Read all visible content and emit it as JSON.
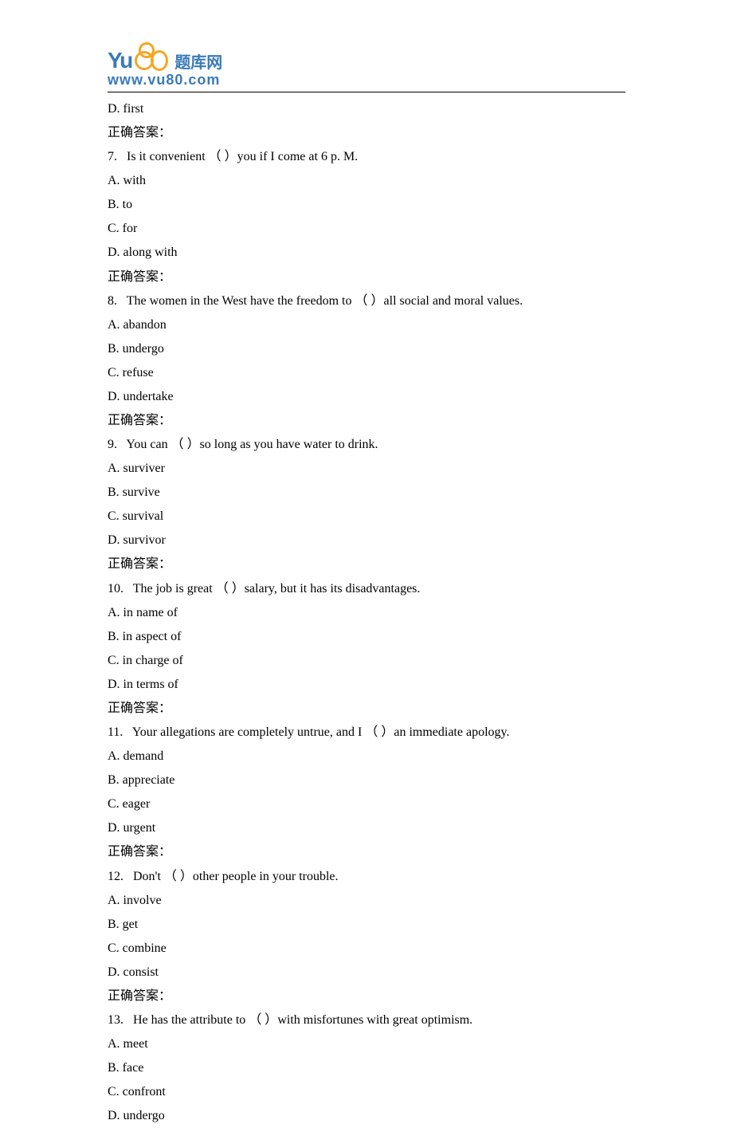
{
  "logo": {
    "brand_prefix": "Yu",
    "brand_chinese": "题库网",
    "url": "www.vu80.com"
  },
  "leading": {
    "option_d": "D. first",
    "answer_label": "正确答案："
  },
  "questions": [
    {
      "num": "7.",
      "text_before": "Is it convenient ",
      "blank": "（       ）",
      "text_after": "you if I come at 6 p. M.",
      "options": [
        "A. with",
        "B. to",
        "C. for",
        "D. along with"
      ],
      "answer_label": "正确答案："
    },
    {
      "num": "8.",
      "text_before": "The women in the West have the freedom to ",
      "blank": "（      ）",
      "text_after": "all social and moral values.",
      "options": [
        "A. abandon",
        "B. undergo",
        "C. refuse",
        "D. undertake"
      ],
      "answer_label": "正确答案："
    },
    {
      "num": "9.",
      "text_before": "You can ",
      "blank": "（       ）",
      "text_after": "so long as you have water to drink.",
      "options": [
        "A. surviver",
        "B. survive",
        "C. survival",
        "D. survivor"
      ],
      "answer_label": "正确答案："
    },
    {
      "num": "10.",
      "text_before": "The job is great ",
      "blank": "（       ）",
      "text_after": "salary, but it has its disadvantages.",
      "options": [
        "A. in name of",
        "B. in aspect of",
        "C. in charge of",
        "D. in terms of"
      ],
      "answer_label": "正确答案："
    },
    {
      "num": "11.",
      "text_before": "Your allegations are completely untrue, and I ",
      "blank": "（      ）",
      "text_after": "an immediate apology.",
      "options": [
        "A. demand",
        "B. appreciate",
        "C. eager",
        "D. urgent"
      ],
      "answer_label": "正确答案："
    },
    {
      "num": "12.",
      "text_before": "Don't ",
      "blank": "（       ）",
      "text_after": "other people in your trouble.",
      "options": [
        "A. involve",
        "B. get",
        "C. combine",
        "D. consist"
      ],
      "answer_label": "正确答案："
    },
    {
      "num": "13.",
      "text_before": "He has the attribute to ",
      "blank": "（       ）",
      "text_after": "with misfortunes with great optimism.",
      "options": [
        "A. meet",
        "B. face",
        "C. confront",
        "D. undergo"
      ],
      "answer_label": ""
    }
  ]
}
